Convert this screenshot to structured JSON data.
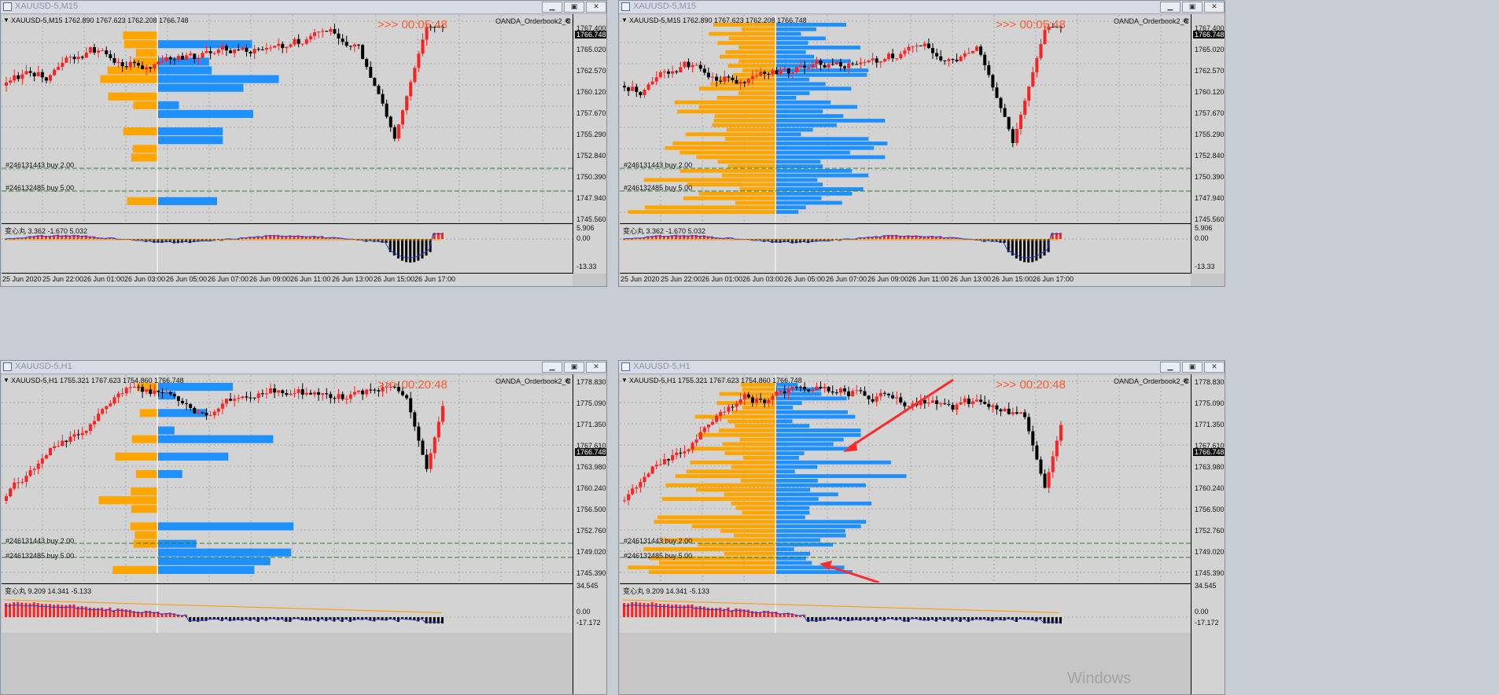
{
  "colors": {
    "bull": "#ff2020",
    "bear": "#000000",
    "sell_book": "#ffa500",
    "buy_book": "#1e90ff",
    "grid": "#a9a9a9",
    "order_line": "#2e7d32",
    "annot_arrow": "#ff2a2a",
    "ma_orange": "#ff9800",
    "ma_blue": "#1f3fd1",
    "vline": "#ffffff"
  },
  "icons": {
    "title": "chart-window-icon",
    "minimize": "minimize-icon",
    "maximize": "maximize-icon",
    "close": "close-icon",
    "dropdown": "dropdown-triangle-icon",
    "indicator_close": "indicator-close-icon"
  },
  "windows": [
    {
      "title": "XAUUSD-5,M15",
      "ohlc": "XAUUSD-5,M15  1762.890 1767.623 1762.208 1766.748",
      "timer": ">>> 00:05:48",
      "indicator": "OANDA_Orderbook2_C",
      "order1": "#246131443 buy 2.00",
      "order2": "#246132485 buy 5.00",
      "prices": [
        "1767.400",
        "1765.020",
        "1762.570",
        "1760.120",
        "1757.670",
        "1755.290",
        "1752.840",
        "1750.390",
        "1747.940",
        "1745.560"
      ],
      "current_price": "1766.748",
      "sub_name": "变心丸 3.362 -1.670 5.032",
      "sub_scale": [
        "5.906",
        "0.00",
        "-13.33"
      ],
      "dates": [
        "25 Jun 2020",
        "25 Jun 22:00",
        "26 Jun 01:00",
        "26 Jun 03:00",
        "26 Jun 05:00",
        "26 Jun 07:00",
        "26 Jun 09:00",
        "26 Jun 11:00",
        "26 Jun 13:00",
        "26 Jun 15:00",
        "26 Jun 17:00"
      ]
    },
    {
      "title": "XAUUSD-5,M15",
      "ohlc": "XAUUSD-5,M15  1762.890 1767.623 1762.208 1766.748",
      "timer": ">>> 00:05:48",
      "indicator": "OANDA_Orderbook2_C",
      "order1": "#246131443 buy 2.00",
      "order2": "#246132485 buy 5.00",
      "prices": [
        "1767.400",
        "1765.020",
        "1762.570",
        "1760.120",
        "1757.670",
        "1755.290",
        "1752.840",
        "1750.390",
        "1747.940",
        "1745.560"
      ],
      "current_price": "1766.748",
      "sub_name": "变心丸 3.362 -1.670 5.032",
      "sub_scale": [
        "5.906",
        "0.00",
        "-13.33"
      ],
      "dates": [
        "25 Jun 2020",
        "25 Jun 22:00",
        "26 Jun 01:00",
        "26 Jun 03:00",
        "26 Jun 05:00",
        "26 Jun 07:00",
        "26 Jun 09:00",
        "26 Jun 11:00",
        "26 Jun 13:00",
        "26 Jun 15:00",
        "26 Jun 17:00"
      ]
    },
    {
      "title": "XAUUSD-5,H1",
      "ohlc": "XAUUSD-5,H1  1755.321 1767.623 1754.860 1766.748",
      "timer": ">>> 00:20:48",
      "indicator": "OANDA_Orderbook2_C",
      "order1": "#246131443 buy 2.00",
      "order2": "#246132485 buy 5.00",
      "prices": [
        "1778.830",
        "1775.090",
        "1771.350",
        "1767.610",
        "1763.980",
        "1760.240",
        "1756.500",
        "1752.760",
        "1749.020",
        "1745.390"
      ],
      "current_price": "1766.748",
      "sub_name": "变心丸 9.209 14.341 -5.133",
      "sub_scale": [
        "34.545",
        "0.00",
        "-17.172"
      ],
      "dates": []
    },
    {
      "title": "XAUUSD-5,H1",
      "ohlc": "XAUUSD-5,H1  1755.321 1767.623 1754.860 1766.748",
      "timer": ">>> 00:20:48",
      "indicator": "OANDA_Orderbook2_C",
      "order1": "#246131443 buy 2.00",
      "order2": "#246132485 buy 5.00",
      "prices": [
        "1778.830",
        "1775.090",
        "1771.350",
        "1767.610",
        "1763.980",
        "1760.240",
        "1756.500",
        "1752.760",
        "1749.020",
        "1745.390"
      ],
      "current_price": "1766.748",
      "sub_name": "变心丸 9.209 14.341 -5.133",
      "sub_scale": [
        "34.545",
        "0.00",
        "-17.172"
      ],
      "dates": []
    }
  ],
  "watermark": "Windows"
}
